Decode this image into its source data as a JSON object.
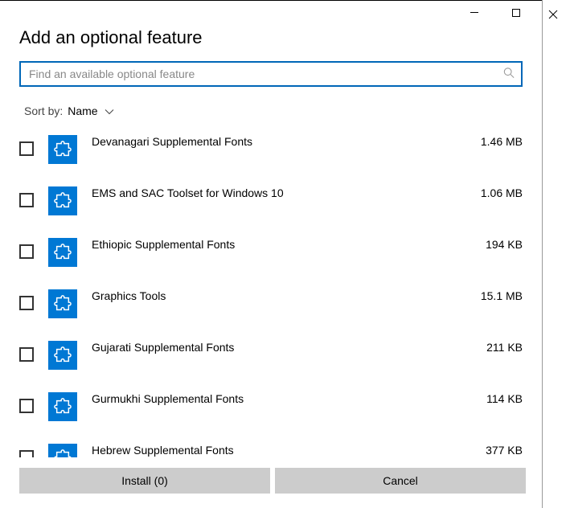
{
  "title": "Add an optional feature",
  "search": {
    "placeholder": "Find an available optional feature",
    "value": ""
  },
  "sort": {
    "label": "Sort by:",
    "value": "Name"
  },
  "features": [
    {
      "name": "Devanagari Supplemental Fonts",
      "size": "1.46 MB"
    },
    {
      "name": "EMS and SAC Toolset for Windows 10",
      "size": "1.06 MB"
    },
    {
      "name": "Ethiopic Supplemental Fonts",
      "size": "194 KB"
    },
    {
      "name": "Graphics Tools",
      "size": "15.1 MB"
    },
    {
      "name": "Gujarati Supplemental Fonts",
      "size": "211 KB"
    },
    {
      "name": "Gurmukhi Supplemental Fonts",
      "size": "114 KB"
    },
    {
      "name": "Hebrew Supplemental Fonts",
      "size": "377 KB"
    }
  ],
  "footer": {
    "install": "Install (0)",
    "cancel": "Cancel"
  }
}
